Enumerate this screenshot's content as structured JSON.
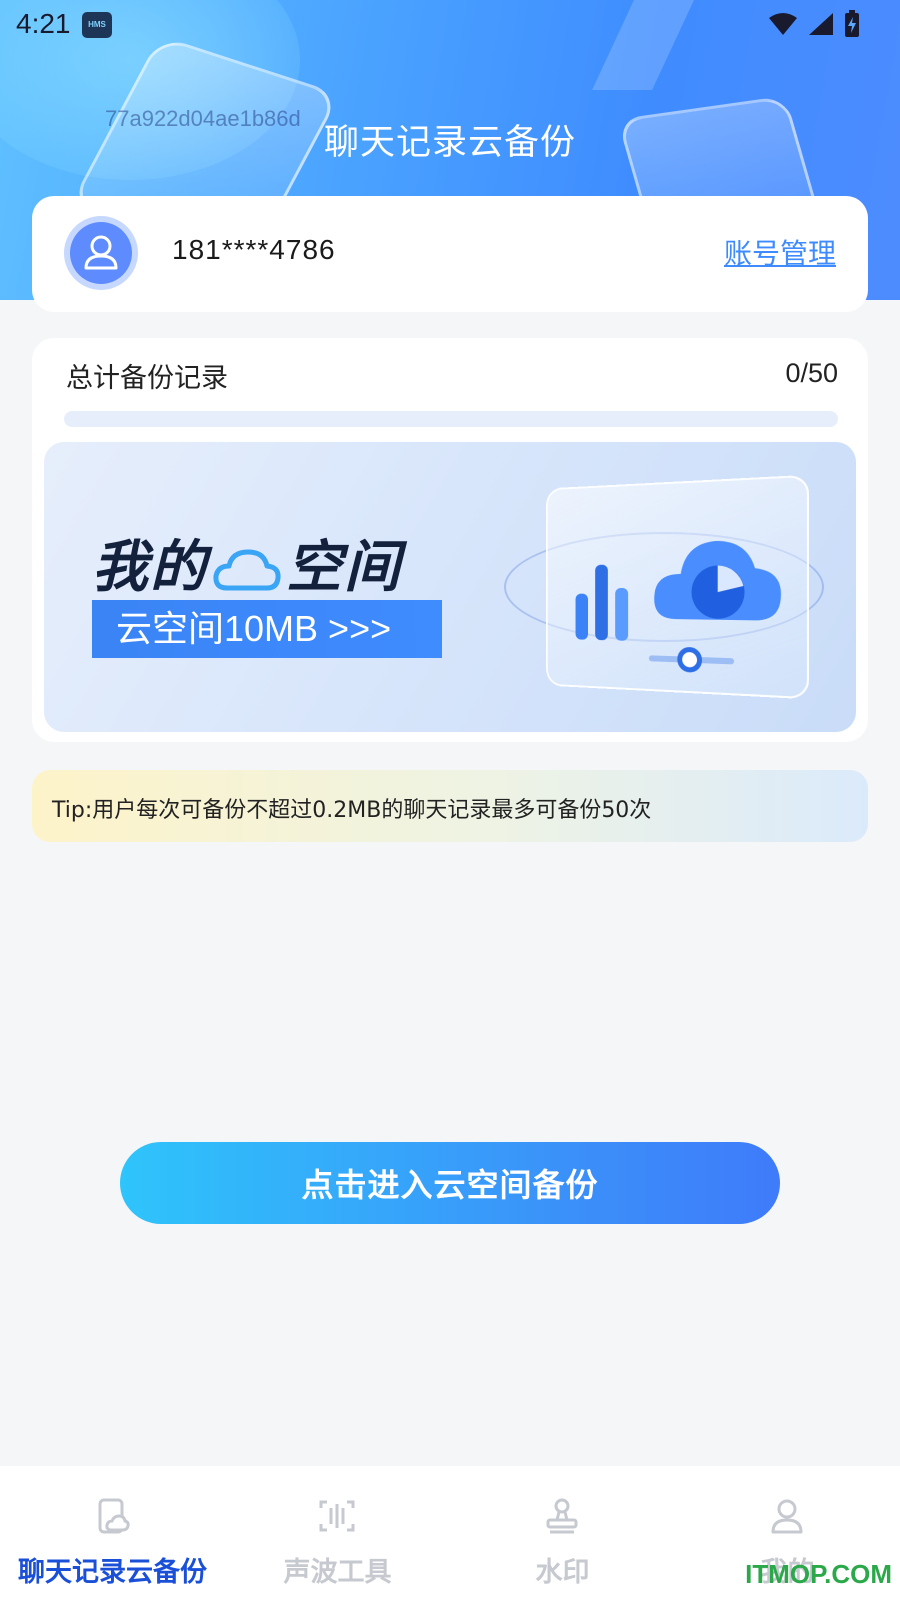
{
  "status_bar": {
    "time": "4:21",
    "hms_badge": "HMS"
  },
  "header": {
    "id_text": "77a922d04ae1b86d",
    "title": "聊天记录云备份"
  },
  "account": {
    "phone": "181****4786",
    "manage_link": "账号管理"
  },
  "backup": {
    "label": "总计备份记录",
    "count_text": "0/50",
    "used": 0,
    "total": 50,
    "banner": {
      "headline_left": "我的",
      "headline_right": "空间",
      "tag_text": "云空间10MB >>>"
    }
  },
  "tip": {
    "text": "Tip:用户每次可备份不超过0.2MB的聊天记录最多可备份50次"
  },
  "cta": {
    "label": "点击进入云空间备份"
  },
  "tabs": [
    {
      "label": "聊天记录云备份",
      "icon": "phone-cloud-icon",
      "active": true
    },
    {
      "label": "声波工具",
      "icon": "soundwave-icon",
      "active": false
    },
    {
      "label": "水印",
      "icon": "stamp-icon",
      "active": false
    },
    {
      "label": "我的",
      "icon": "user-icon",
      "active": false
    }
  ],
  "watermark": "ITMOP.COM",
  "colors": {
    "accent": "#3d8bff",
    "active_tab": "#1a4fd8",
    "inactive_tab": "#c6c9cf"
  }
}
